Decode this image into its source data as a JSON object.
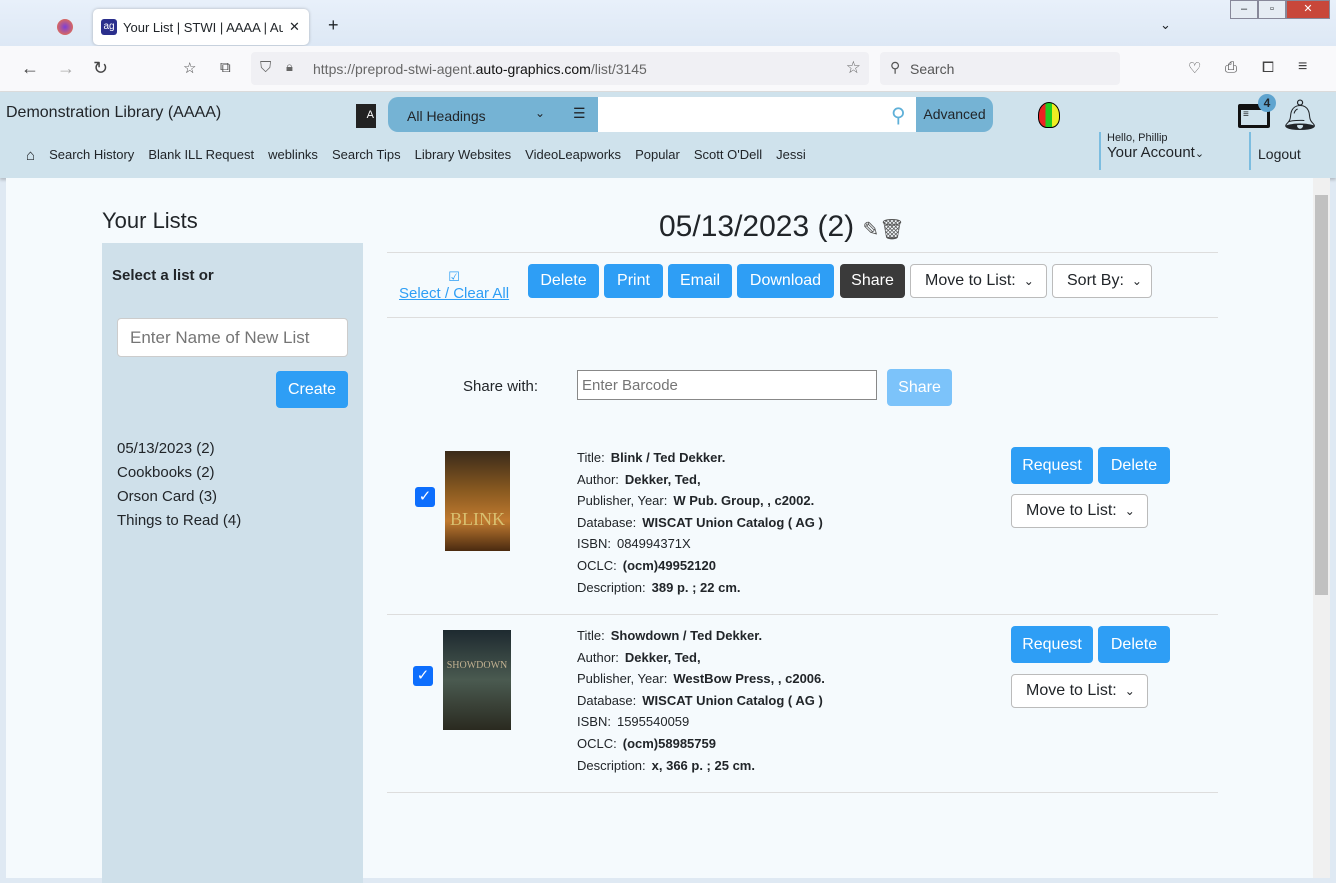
{
  "browser": {
    "tab_title": "Your List | STWI | AAAA | Auto-G",
    "url_prefix": "https://preprod-stwi-agent.",
    "url_domain": "auto-graphics.com",
    "url_path": "/list/3145",
    "search_placeholder": "Search"
  },
  "header": {
    "library": "Demonstration Library (AAAA)",
    "heading_select": "All Headings",
    "advanced": "Advanced",
    "badge_count": "4",
    "hello": "Hello, Phillip",
    "account": "Your Account",
    "logout": "Logout",
    "menu": [
      "Search History",
      "Blank ILL Request",
      "weblinks",
      "Search Tips",
      "Library Websites",
      "VideoLeapworks",
      "Popular",
      "Scott O'Dell",
      "Jessi"
    ]
  },
  "sidebar": {
    "title": "Your Lists",
    "select_label": "Select a list or",
    "new_list_placeholder": "Enter Name of New List",
    "create": "Create",
    "lists": [
      "05/13/2023 (2)",
      "Cookbooks (2)",
      "Orson Card (3)",
      "Things to Read (4)"
    ]
  },
  "main": {
    "list_title": "05/13/2023 (2)",
    "select_clear": "Select / Clear All",
    "toolbar": {
      "delete": "Delete",
      "print": "Print",
      "email": "Email",
      "download": "Download",
      "share": "Share",
      "move": "Move to List:",
      "sort": "Sort By:"
    },
    "share_with": "Share with:",
    "barcode_placeholder": "Enter Barcode",
    "share_btn": "Share",
    "labels": {
      "title": "Title:",
      "author": "Author:",
      "publisher": "Publisher, Year:",
      "database": "Database:",
      "isbn": "ISBN:",
      "oclc": "OCLC:",
      "description": "Description:"
    },
    "item_actions": {
      "request": "Request",
      "delete": "Delete",
      "move": "Move to List:"
    },
    "items": [
      {
        "title": "Blink / Ted Dekker.",
        "author": "Dekker, Ted,",
        "publisher": "W Pub. Group, , c2002.",
        "database": "WISCAT Union Catalog ( AG )",
        "isbn": "084994371X",
        "oclc": "(ocm)49952120",
        "description": "389 p. ; 22 cm.",
        "checked": true
      },
      {
        "title": "Showdown / Ted Dekker.",
        "author": "Dekker, Ted,",
        "publisher": "WestBow Press, , c2006.",
        "database": "WISCAT Union Catalog ( AG )",
        "isbn": "1595540059",
        "oclc": "(ocm)58985759",
        "description": "x, 366 p. ; 25 cm.",
        "checked": true
      }
    ]
  },
  "colors": {
    "accent": "#2e9ef5",
    "header_bg": "#cfe2ec",
    "share_dark": "#3a3a3a"
  }
}
